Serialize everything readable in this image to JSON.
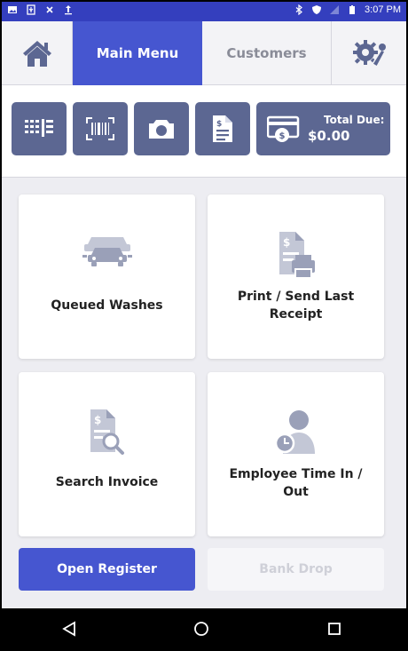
{
  "status_bar": {
    "time": "3:07 PM",
    "background": "#343fbe",
    "left_icons": [
      "image-icon",
      "usb-icon",
      "close-icon",
      "upload-icon"
    ],
    "right_icons": [
      "bluetooth-icon",
      "vpn-shield-icon",
      "signal-icon",
      "battery-icon"
    ]
  },
  "nav": {
    "home_icon": "home-icon",
    "tabs": [
      {
        "label": "Main Menu",
        "active": true
      },
      {
        "label": "Customers",
        "active": false
      }
    ],
    "settings_icon": "gear-wrench-icon",
    "accent": "#4656d0"
  },
  "toolbar": {
    "tools": [
      {
        "icon": "keypad-icon"
      },
      {
        "icon": "barcode-scan-icon"
      },
      {
        "icon": "camera-icon"
      },
      {
        "icon": "document-icon"
      }
    ],
    "total_due_label": "Total Due:",
    "total_due_amount": "$0.00",
    "total_due_icon": "card-dollar-icon",
    "tool_color": "#5c6792"
  },
  "cards": [
    {
      "label": "Queued Washes",
      "icon": "cars-queue-icon"
    },
    {
      "label": "Print / Send Last Receipt",
      "icon": "receipt-print-icon"
    },
    {
      "label": "Search Invoice",
      "icon": "invoice-search-icon"
    },
    {
      "label": "Employee Time In / Out",
      "icon": "employee-clock-icon"
    }
  ],
  "bottom_buttons": {
    "open_register": "Open Register",
    "bank_drop": "Bank Drop",
    "bank_drop_disabled": true
  },
  "android_nav": {
    "back_icon": "back-triangle-icon",
    "home_icon": "home-circle-icon",
    "recent_icon": "recent-square-icon"
  }
}
